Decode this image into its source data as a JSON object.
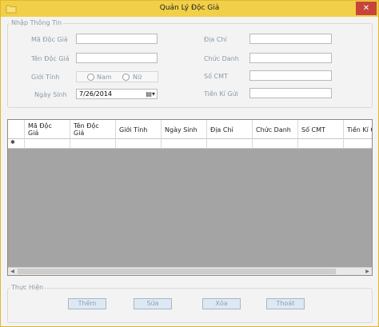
{
  "window": {
    "title": "Quản Lý Độc Giả",
    "close_label": "✕",
    "app_icon": "folder-icon"
  },
  "info_group": {
    "title": "Nhập Thông Tin",
    "fields": {
      "ma_doc_gia": {
        "label": "Mã Độc Giả",
        "value": ""
      },
      "ten_doc_gia": {
        "label": "Tên Độc Giả",
        "value": ""
      },
      "gioi_tinh": {
        "label": "Giới Tính",
        "options": [
          "Nam",
          "Nữ"
        ]
      },
      "ngay_sinh": {
        "label": "Ngày Sinh",
        "value": "7/26/2014"
      },
      "dia_chi": {
        "label": "Địa Chỉ",
        "value": ""
      },
      "chuc_danh": {
        "label": "Chức Danh",
        "value": ""
      },
      "so_cmt": {
        "label": "Số CMT",
        "value": ""
      },
      "tien_ki_gui": {
        "label": "Tiền Kí Gửi",
        "value": ""
      }
    }
  },
  "grid": {
    "columns": [
      "Mã Độc\nGiả",
      "Tên Độc\nGiả",
      "Giới Tính",
      "Ngày Sinh",
      "Địa Chỉ",
      "Chức Danh",
      "Số CMT",
      "Tiền Kí G"
    ],
    "new_row_marker": "✱"
  },
  "actions_group": {
    "title": "Thực Hiện",
    "buttons": {
      "add": "Thêm",
      "edit": "Sửa",
      "delete": "Xóa",
      "exit": "Thoát"
    }
  },
  "colors": {
    "titlebar": "#f1cf48",
    "close": "#c7443a",
    "grid_bg": "#a4a4a4"
  }
}
